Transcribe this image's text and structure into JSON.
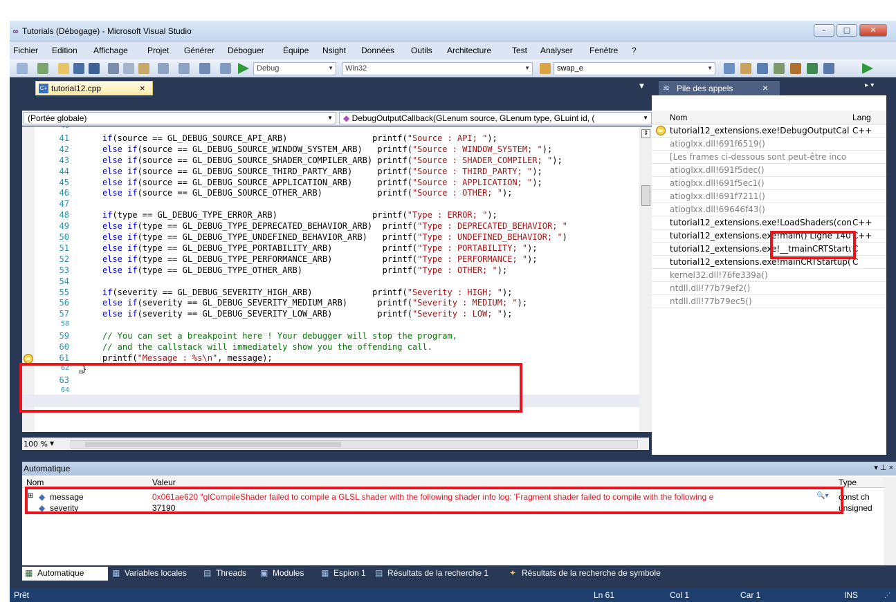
{
  "window": {
    "title": "Tutorials (Débogage) - Microsoft Visual Studio",
    "logo": "∞",
    "controls": {
      "minimize": "–",
      "maximize": "□",
      "close": "✕"
    }
  },
  "menu": [
    "Fichier",
    "Edition",
    "Affichage",
    "Projet",
    "Générer",
    "Déboguer",
    "Équipe",
    "Nsight",
    "Données",
    "Outils",
    "Architecture",
    "Test",
    "Analyser",
    "Fenêtre",
    "?"
  ],
  "toolbar": {
    "config": "Debug",
    "platform": "Win32",
    "find": "swap_e"
  },
  "editor": {
    "tab_label": "tutorial12.cpp",
    "tab_close": "×",
    "scope": "(Portée globale)",
    "member": "DebugOutputCallback(GLenum source, GLenum type, GLuint id, (",
    "zoom": "100 %",
    "lines": [
      {
        "n": "40",
        "parts": []
      },
      {
        "n": "41",
        "parts": [
          [
            "kw",
            "if"
          ],
          [
            "t",
            "(source == GL_DEBUG_SOURCE_API_ARB)                 printf("
          ],
          [
            "s",
            "\"Source : API; \""
          ],
          [
            "t",
            ");"
          ]
        ]
      },
      {
        "n": "42",
        "parts": [
          [
            "kw",
            "else if"
          ],
          [
            "t",
            "(source == GL_DEBUG_SOURCE_WINDOW_SYSTEM_ARB)   printf("
          ],
          [
            "s",
            "\"Source : WINDOW_SYSTEM; \""
          ],
          [
            "t",
            ");"
          ]
        ]
      },
      {
        "n": "43",
        "parts": [
          [
            "kw",
            "else if"
          ],
          [
            "t",
            "(source == GL_DEBUG_SOURCE_SHADER_COMPILER_ARB) printf("
          ],
          [
            "s",
            "\"Source : SHADER_COMPILER; \""
          ],
          [
            "t",
            ");"
          ]
        ]
      },
      {
        "n": "44",
        "parts": [
          [
            "kw",
            "else if"
          ],
          [
            "t",
            "(source == GL_DEBUG_SOURCE_THIRD_PARTY_ARB)     printf("
          ],
          [
            "s",
            "\"Source : THIRD_PARTY; \""
          ],
          [
            "t",
            ");"
          ]
        ]
      },
      {
        "n": "45",
        "parts": [
          [
            "kw",
            "else if"
          ],
          [
            "t",
            "(source == GL_DEBUG_SOURCE_APPLICATION_ARB)     printf("
          ],
          [
            "s",
            "\"Source : APPLICATION; \""
          ],
          [
            "t",
            ");"
          ]
        ]
      },
      {
        "n": "46",
        "parts": [
          [
            "kw",
            "else if"
          ],
          [
            "t",
            "(source == GL_DEBUG_SOURCE_OTHER_ARB)           printf("
          ],
          [
            "s",
            "\"Source : OTHER; \""
          ],
          [
            "t",
            ");"
          ]
        ]
      },
      {
        "n": "47",
        "parts": []
      },
      {
        "n": "48",
        "parts": [
          [
            "kw",
            "if"
          ],
          [
            "t",
            "(type == GL_DEBUG_TYPE_ERROR_ARB)                   printf("
          ],
          [
            "s",
            "\"Type : ERROR; \""
          ],
          [
            "t",
            ");"
          ]
        ]
      },
      {
        "n": "49",
        "parts": [
          [
            "kw",
            "else if"
          ],
          [
            "t",
            "(type == GL_DEBUG_TYPE_DEPRECATED_BEHAVIOR_ARB)  printf("
          ],
          [
            "s",
            "\"Type : DEPRECATED_BEHAVIOR; \""
          ]
        ]
      },
      {
        "n": "50",
        "parts": [
          [
            "kw",
            "else if"
          ],
          [
            "t",
            "(type == GL_DEBUG_TYPE_UNDEFINED_BEHAVIOR_ARB)   printf("
          ],
          [
            "s",
            "\"Type : UNDEFINED_BEHAVIOR; \""
          ],
          [
            "t",
            ")"
          ]
        ]
      },
      {
        "n": "51",
        "parts": [
          [
            "kw",
            "else if"
          ],
          [
            "t",
            "(type == GL_DEBUG_TYPE_PORTABILITY_ARB)          printf("
          ],
          [
            "s",
            "\"Type : PORTABILITY; \""
          ],
          [
            "t",
            ");"
          ]
        ]
      },
      {
        "n": "52",
        "parts": [
          [
            "kw",
            "else if"
          ],
          [
            "t",
            "(type == GL_DEBUG_TYPE_PERFORMANCE_ARB)          printf("
          ],
          [
            "s",
            "\"Type : PERFORMANCE; \""
          ],
          [
            "t",
            ");"
          ]
        ]
      },
      {
        "n": "53",
        "parts": [
          [
            "kw",
            "else if"
          ],
          [
            "t",
            "(type == GL_DEBUG_TYPE_OTHER_ARB)                printf("
          ],
          [
            "s",
            "\"Type : OTHER; \""
          ],
          [
            "t",
            ");"
          ]
        ]
      },
      {
        "n": "54",
        "parts": []
      },
      {
        "n": "55",
        "parts": [
          [
            "kw",
            "if"
          ],
          [
            "t",
            "(severity == GL_DEBUG_SEVERITY_HIGH_ARB)            printf("
          ],
          [
            "s",
            "\"Severity : HIGH; \""
          ],
          [
            "t",
            ");"
          ]
        ]
      },
      {
        "n": "56",
        "parts": [
          [
            "kw",
            "else if"
          ],
          [
            "t",
            "(severity == GL_DEBUG_SEVERITY_MEDIUM_ARB)      printf("
          ],
          [
            "s",
            "\"Severity : MEDIUM; \""
          ],
          [
            "t",
            ");"
          ]
        ]
      },
      {
        "n": "57",
        "parts": [
          [
            "kw",
            "else if"
          ],
          [
            "t",
            "(severity == GL_DEBUG_SEVERITY_LOW_ARB)         printf("
          ],
          [
            "s",
            "\"Severity : LOW; \""
          ],
          [
            "t",
            ");"
          ]
        ]
      },
      {
        "n": "58",
        "parts": []
      },
      {
        "n": "59",
        "parts": [
          [
            "c",
            "// You can set a breakpoint here ! Your debugger will stop the program,"
          ]
        ]
      },
      {
        "n": "60",
        "parts": [
          [
            "c",
            "// and the callstack will immediately show you the offending call."
          ]
        ]
      },
      {
        "n": "61",
        "parts": [
          [
            "t",
            "printf("
          ],
          [
            "s",
            "\"Message : %s\\n\""
          ],
          [
            "t",
            ", message);"
          ]
        ]
      },
      {
        "n": "62",
        "parts": [
          [
            "t",
            "}"
          ]
        ]
      },
      {
        "n": "63",
        "parts": []
      },
      {
        "n": "64",
        "parts": []
      }
    ]
  },
  "callstack": {
    "tab_label": "Pile des appels",
    "tab_close": "×",
    "col_name": "Nom",
    "col_lang": "Lang",
    "rows": [
      {
        "name": "tutorial12_extensions.exe!DebugOutputCal",
        "lang": "C++",
        "dim": false,
        "current": true
      },
      {
        "name": "atioglxx.dll!691f6519()",
        "lang": "",
        "dim": true
      },
      {
        "name": "[Les frames ci-dessous sont peut-être inco",
        "lang": "",
        "dim": true
      },
      {
        "name": "atioglxx.dll!691f5dec()",
        "lang": "",
        "dim": true
      },
      {
        "name": "atioglxx.dll!691f5ec1()",
        "lang": "",
        "dim": true
      },
      {
        "name": "atioglxx.dll!691f7211()",
        "lang": "",
        "dim": true
      },
      {
        "name": "atioglxx.dll!69646f43()",
        "lang": "",
        "dim": true
      },
      {
        "name": "tutorial12_extensions.exe!LoadShaders(con",
        "lang": "C++",
        "dim": false
      },
      {
        "name": "tutorial12_extensions.exe!main()  Ligne 140",
        "lang": "C++",
        "dim": false
      },
      {
        "name": "tutorial12_extensions.exe!__tmainCRTStartu",
        "lang": "C",
        "dim": false
      },
      {
        "name": "tutorial12_extensions.exe!mainCRTStartup(",
        "lang": "C",
        "dim": false
      },
      {
        "name": "kernel32.dll!76fe339a()",
        "lang": "",
        "dim": true
      },
      {
        "name": "ntdll.dll!77b79ef2()",
        "lang": "",
        "dim": true
      },
      {
        "name": "ntdll.dll!77b79ec5()",
        "lang": "",
        "dim": true
      }
    ]
  },
  "auto": {
    "title": "Automatique",
    "title_controls": "▾ ⊥ ×",
    "col_name": "Nom",
    "col_value": "Valeur",
    "col_type": "Type",
    "rows": [
      {
        "name": "message",
        "value": "0x061ae620 \"glCompileShader failed to compile a GLSL shader with the following shader info log: 'Fragment shader failed to compile with the following e",
        "type": "const ch"
      },
      {
        "name": "severity",
        "value": "37190",
        "type": "unsigned"
      }
    ]
  },
  "bottom_tabs": [
    "Automatique",
    "Variables locales",
    "Threads",
    "Modules",
    "Espion 1",
    "Résultats de la recherche 1",
    "Résultats de la recherche de symbole"
  ],
  "status": {
    "ready": "Prêt",
    "line": "Ln 61",
    "col": "Col 1",
    "car": "Car 1",
    "ins": "INS"
  },
  "colors": {
    "frame": "#293955",
    "highlight": "#e8141e",
    "keyword": "#0000ff",
    "string": "#a31515",
    "comment": "#008000",
    "line_number": "#2b91af"
  }
}
